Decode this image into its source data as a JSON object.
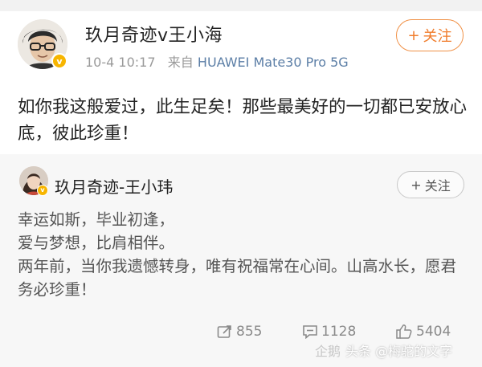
{
  "post": {
    "username": "玖月奇迹v王小海",
    "time": "10-4 10:17",
    "source_prefix": "来自",
    "device": "HUAWEI Mate30 Pro 5G",
    "follow_label": "关注",
    "content": "如你我这般爱过，此生足矣！那些最美好的一切都已安放心底，彼此珍重！",
    "verified_badge": "v-badge-icon"
  },
  "repost": {
    "username": "玖月奇迹-王小玮",
    "follow_label": "关注",
    "lines": [
      "幸运如斯，毕业初逢，",
      "爱与梦想，比肩相伴。",
      "两年前，当你我遗憾转身，唯有祝福常在心间。山高水长，愿君务必珍重！"
    ],
    "stats": {
      "reposts": "855",
      "comments": "1128",
      "likes": "5404"
    }
  },
  "watermark": {
    "brand": "企鹅",
    "text": "头条 @梅驼的文字"
  },
  "colors": {
    "accent": "#f07c2b",
    "device_link": "#5b7ea6",
    "badge": "#f7b500"
  }
}
